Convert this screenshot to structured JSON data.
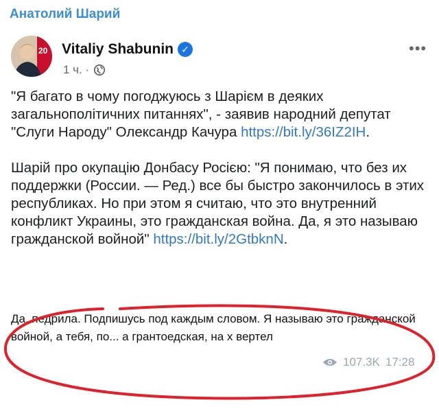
{
  "channel": {
    "name": "Анатолий Шарий"
  },
  "post": {
    "author": "Vitaliy Shabunin",
    "verified_icon": "verified-check-icon",
    "time": "1 ч. ·",
    "audience_icon": "globe-icon",
    "more_icon": "more-options-icon",
    "paragraph1": "\"Я багато в чому погоджуюсь з Шарієм в деяких загальнополітичних питаннях\", - заявив народний депутат \"Слуги Народу\" Олександр Качура ",
    "link1": "https://bit.ly/36IZ2IH",
    "link1_tail": ".",
    "paragraph2": "Шарій про окупацію Донбасу Росією: \"Я понимаю, что без их поддержки (России. — Ред.) все бы быстро закончилось в этих республиках. Но при этом я считаю, что это внутренний конфликт Украины, это гражданская война. Да, я это называю гражданской войной\" ",
    "link2": "https://bit.ly/2GtbknN",
    "link2_tail": "."
  },
  "message": {
    "text": "Да, педрила. Подпишусь под каждым словом. Я называю это гражданской войной, а тебя, по... а грантоедская, на х вертел",
    "views": "107.3K",
    "time": "17:28"
  },
  "colors": {
    "accent": "#3a8fd1",
    "link": "#3278c5",
    "annotation": "#e0202a"
  }
}
